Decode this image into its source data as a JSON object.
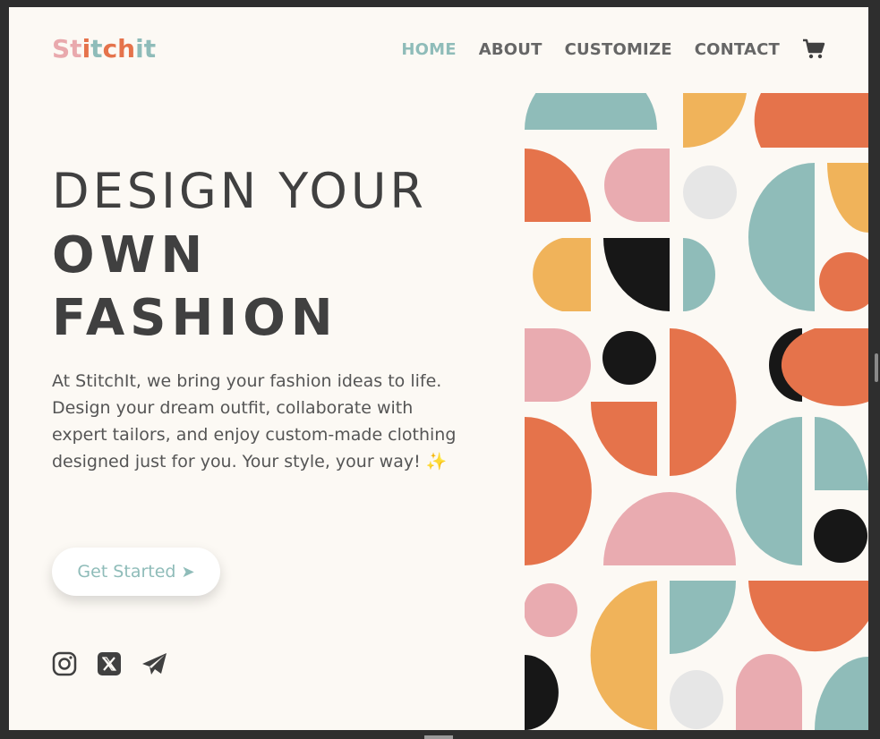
{
  "logo": {
    "letters": [
      "S",
      "t",
      "i",
      "t",
      "c",
      "h",
      "i",
      "t"
    ],
    "colors": [
      "#e9a9ad",
      "#e9a9ad",
      "#8fbcb9",
      "#8fbcb9",
      "#e5734b",
      "#e5734b",
      "#8fbcb9",
      "#8fbcb9"
    ]
  },
  "nav": {
    "items": [
      {
        "label": "HOME",
        "active": true
      },
      {
        "label": "ABOUT",
        "active": false
      },
      {
        "label": "CUSTOMIZE",
        "active": false
      },
      {
        "label": "CONTACT",
        "active": false
      }
    ],
    "cart_icon": "cart-icon"
  },
  "hero": {
    "line1": "DESIGN YOUR",
    "line2": "OWN",
    "line3": "FASHION",
    "description": "At StitchIt, we bring your fashion ideas to life. Design your dream outfit, collaborate with expert tailors, and enjoy custom-made clothing designed just for you. Your style, your way! ✨",
    "cta_label": "Get Started",
    "cta_arrow": "➤"
  },
  "social": [
    "instagram-icon",
    "x-icon",
    "telegram-icon"
  ],
  "palette": {
    "teal": "#8fbcb9",
    "orange": "#e5734b",
    "pink": "#e9abb0",
    "yellow": "#f0b35a",
    "black": "#171717",
    "gray": "#e6e6e6",
    "text": "#404040"
  }
}
